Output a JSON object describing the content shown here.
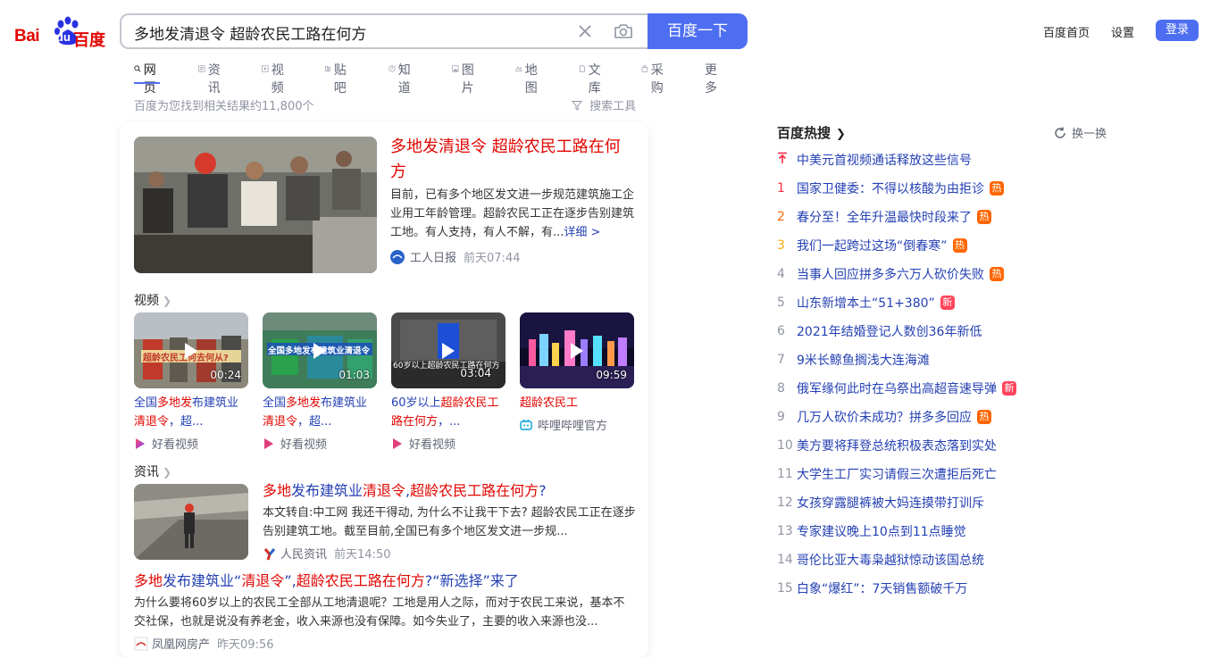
{
  "logo": {
    "bai": "Bai",
    "du": "du",
    "baidu_cn": "百度"
  },
  "search": {
    "query": "多地发清退令 超龄农民工路在何方",
    "button": "百度一下"
  },
  "top_links": {
    "home": "百度首页",
    "settings": "设置",
    "login": "登录"
  },
  "tabs": [
    "网页",
    "资讯",
    "视频",
    "贴吧",
    "知道",
    "图片",
    "地图",
    "文库",
    "采购",
    "更多"
  ],
  "result_count": "百度为您找到相关结果约11,800个",
  "search_tools": "搜索工具",
  "main_result": {
    "title": "多地发清退令 超龄农民工路在何方",
    "abstract": "目前，已有多个地区发文进一步规范建筑施工企业用工年龄管理。超龄农民工正在逐步告别建筑工地。有人支持，有人不解，有...",
    "more": "详细 >",
    "source": "工人日报",
    "time": "前天07:44"
  },
  "video_section": {
    "heading": "视频",
    "items": [
      {
        "title_pre": "全国",
        "title_em": "多地发",
        "title_post": "布建筑业",
        "title_line2_em": "清退令",
        "title_line2_post": "，超...",
        "duration": "00:24",
        "thumb_text": "超龄农民工何去何从?",
        "source": "好看视频"
      },
      {
        "title_pre": "全国",
        "title_em": "多地发",
        "title_post": "布建筑业",
        "title_line2_em": "清退令",
        "title_line2_post": "，超...",
        "duration": "01:03",
        "thumb_text": "全国多地发布建筑业清退令",
        "source": "好看视频"
      },
      {
        "title_pre": "60岁以上",
        "title_em": "超龄农民工",
        "title_post": "",
        "title_line2_em": "路在何方",
        "title_line2_post": "，...",
        "duration": "03:04",
        "thumb_text": "60岁以上超龄农民工路在何方",
        "source": "好看视频"
      },
      {
        "title_pre": "",
        "title_em": "超龄农民工",
        "title_post": "",
        "title_line2_em": "",
        "title_line2_post": "",
        "duration": "09:59",
        "thumb_text": "",
        "source": "哔哩哔哩官方"
      }
    ]
  },
  "news_section": {
    "heading": "资讯",
    "item1": {
      "title_a": "多地",
      "title_b": "发布建筑业",
      "title_c": "清退令",
      "title_d": ",",
      "title_e": "超龄农民工路在何方",
      "title_f": "?",
      "abstract": "本文转自:中工网 我还干得动, 为什么不让我干下去? 超龄农民工正在逐步告别建筑工地。截至目前,全国已有多个地区发文进一步规...",
      "source": "人民资讯",
      "time": "前天14:50"
    },
    "item2": {
      "title_a": "多地",
      "title_b": "发布建筑业“",
      "title_c": "清退令",
      "title_d": "”,",
      "title_e": "超龄农民工路在何方",
      "title_f": "?“新选择”来了",
      "abstract": "为什么要将60岁以上的农民工全部从工地清退呢？工地是用人之际，而对于农民工来说，基本不交社保，也就是说没有养老金，收入来源也没有保障。如今失业了，主要的收入来源也没...",
      "source": "凤凰网房产",
      "time": "昨天09:56"
    }
  },
  "hot": {
    "heading": "百度热搜",
    "refresh": "换一换",
    "items": [
      {
        "rank": "",
        "title": "中美元首视频通话释放这些信号",
        "badge": ""
      },
      {
        "rank": "1",
        "title": "国家卫健委：不得以核酸为由拒诊",
        "badge": "热"
      },
      {
        "rank": "2",
        "title": "春分至！全年升温最快时段来了",
        "badge": "热"
      },
      {
        "rank": "3",
        "title": "我们一起跨过这场“倒春寒”",
        "badge": "热"
      },
      {
        "rank": "4",
        "title": "当事人回应拼多多六万人砍价失败",
        "badge": "热"
      },
      {
        "rank": "5",
        "title": "山东新增本土“51+380”",
        "badge": "新"
      },
      {
        "rank": "6",
        "title": "2021年结婚登记人数创36年新低",
        "badge": ""
      },
      {
        "rank": "7",
        "title": "9米长鲸鱼搁浅大连海滩",
        "badge": ""
      },
      {
        "rank": "8",
        "title": "俄军缘何此时在乌祭出高超音速导弹",
        "badge": "新"
      },
      {
        "rank": "9",
        "title": "几万人砍价未成功？拼多多回应",
        "badge": "热"
      },
      {
        "rank": "10",
        "title": "美方要将拜登总统积极表态落到实处",
        "badge": ""
      },
      {
        "rank": "11",
        "title": "大学生工厂实习请假三次遭拒后死亡",
        "badge": ""
      },
      {
        "rank": "12",
        "title": "女孩穿露腿裤被大妈连摸带打训斥",
        "badge": ""
      },
      {
        "rank": "13",
        "title": "专家建议晚上10点到11点睡觉",
        "badge": ""
      },
      {
        "rank": "14",
        "title": "哥伦比亚大毒枭越狱惊动该国总统",
        "badge": ""
      },
      {
        "rank": "15",
        "title": "白象“爆红”：7天销售额破千万",
        "badge": ""
      }
    ]
  },
  "colors": {
    "brand_blue": "#4e6ef2",
    "brand_red": "#e10601",
    "link_blue": "#2440b3",
    "hot_badge": "#ff6600",
    "new_badge": "#ff455b",
    "rank_1": "#fe2d46",
    "rank_2": "#f60",
    "rank_3": "#faa90e"
  }
}
